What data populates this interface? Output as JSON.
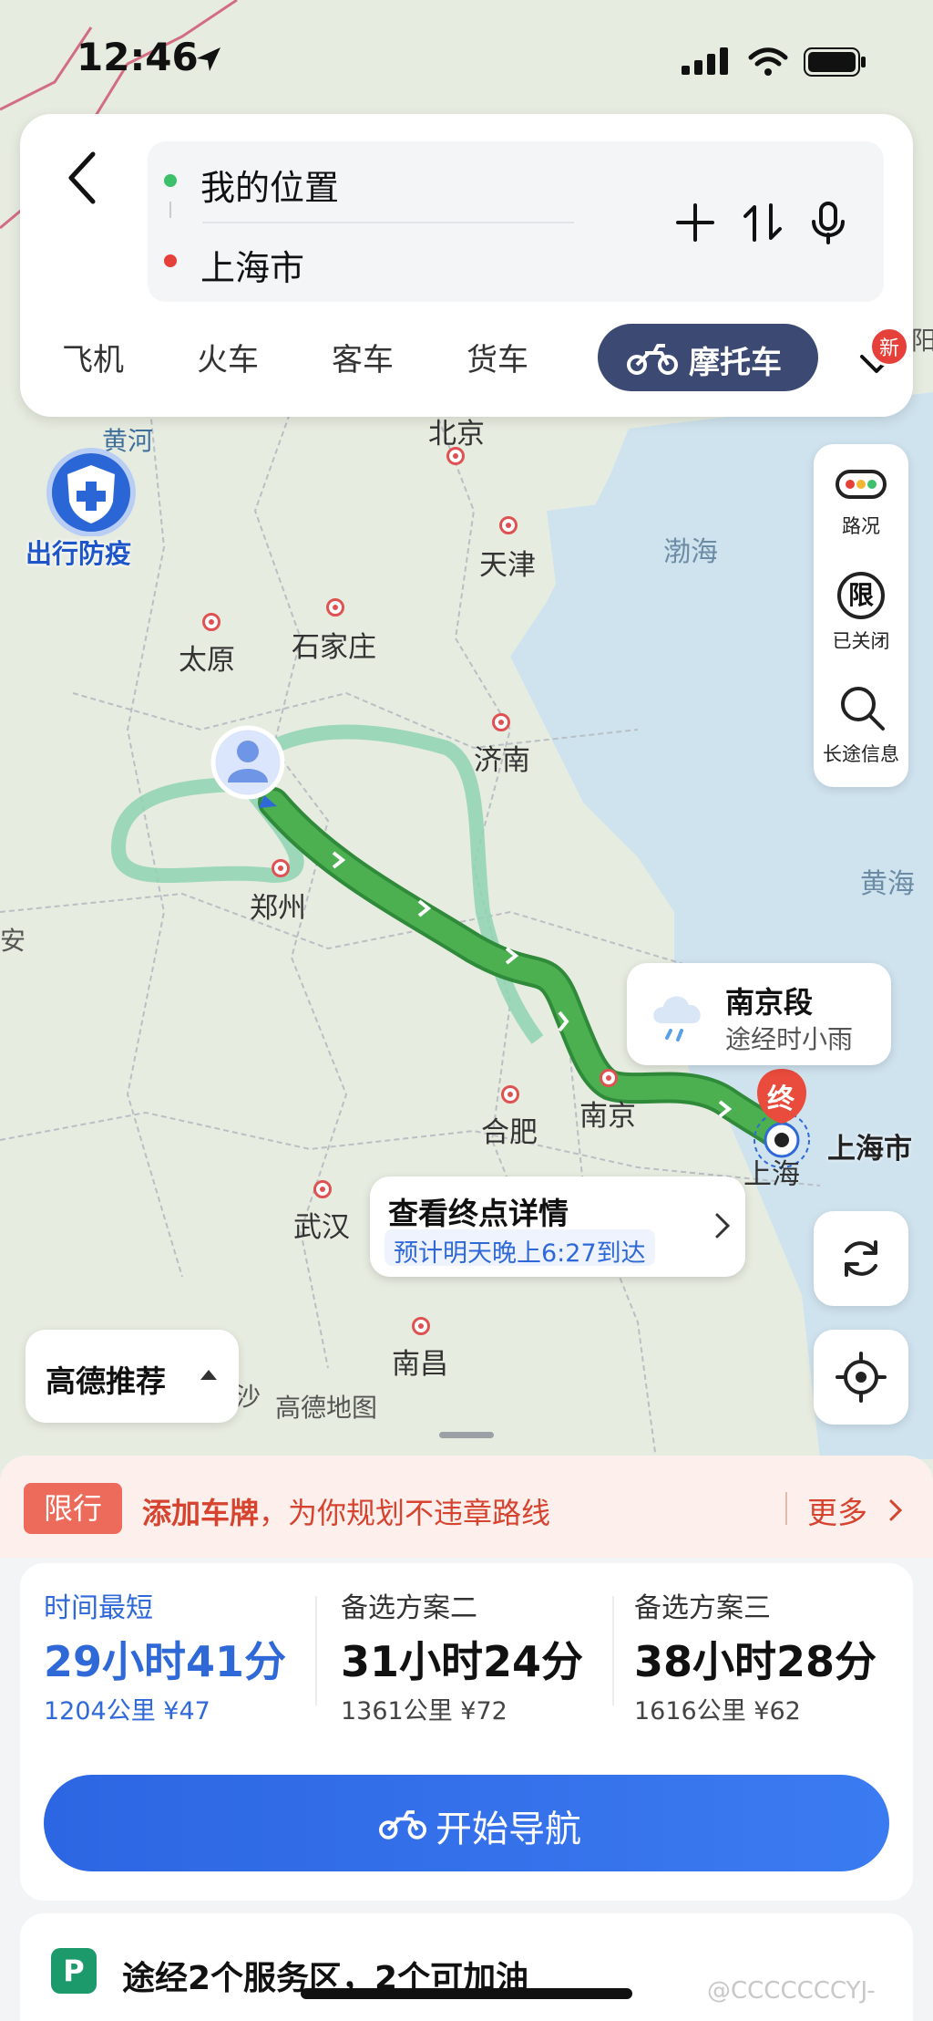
{
  "status_bar": {
    "time": "12:46"
  },
  "search": {
    "origin": "我的位置",
    "destination": "上海市"
  },
  "transport_tabs": [
    "飞机",
    "火车",
    "客车",
    "货车",
    "摩托车"
  ],
  "new_badge": "新",
  "map": {
    "cities": [
      {
        "name": "北京"
      },
      {
        "name": "天津"
      },
      {
        "name": "石家庄"
      },
      {
        "name": "太原"
      },
      {
        "name": "济南"
      },
      {
        "name": "郑州"
      },
      {
        "name": "合肥"
      },
      {
        "name": "南京"
      },
      {
        "name": "上海"
      },
      {
        "name": "武汉"
      },
      {
        "name": "南昌"
      }
    ],
    "labels": [
      "黄河",
      "渤海",
      "黄海",
      "沙",
      "高德地图",
      "阳",
      "安"
    ],
    "destination_label": "上海市",
    "end_marker": "终",
    "epidemic_label": "出行防疫"
  },
  "tools": {
    "traffic": "路况",
    "restriction": "已关闭",
    "restriction_glyph": "限",
    "long_trip": "长途信息"
  },
  "weather_card": {
    "title": "南京段",
    "subtitle": "途经时小雨"
  },
  "destination_card": {
    "title": "查看终点详情",
    "eta": "预计明天晚上6:27到达"
  },
  "recommend_button": "高德推荐",
  "limit_bar": {
    "tag": "限行",
    "highlight": "添加车牌",
    "text": "，为你规划不违章路线",
    "more": "更多"
  },
  "plans": [
    {
      "label": "时间最短",
      "time": "29小时41分",
      "meta": "1204公里  ¥47"
    },
    {
      "label": "备选方案二",
      "time": "31小时24分",
      "meta": "1361公里  ¥72"
    },
    {
      "label": "备选方案三",
      "time": "38小时28分",
      "meta": "1616公里  ¥62"
    }
  ],
  "start_button": "开始导航",
  "service_info": "途经2个服务区，2个可加油",
  "watermark": "@CCCCCCCYJ-",
  "colors": {
    "accent": "#2f69d8",
    "route": "#4caf50",
    "alert": "#d6432f",
    "tab_active": "#3c4a73"
  }
}
